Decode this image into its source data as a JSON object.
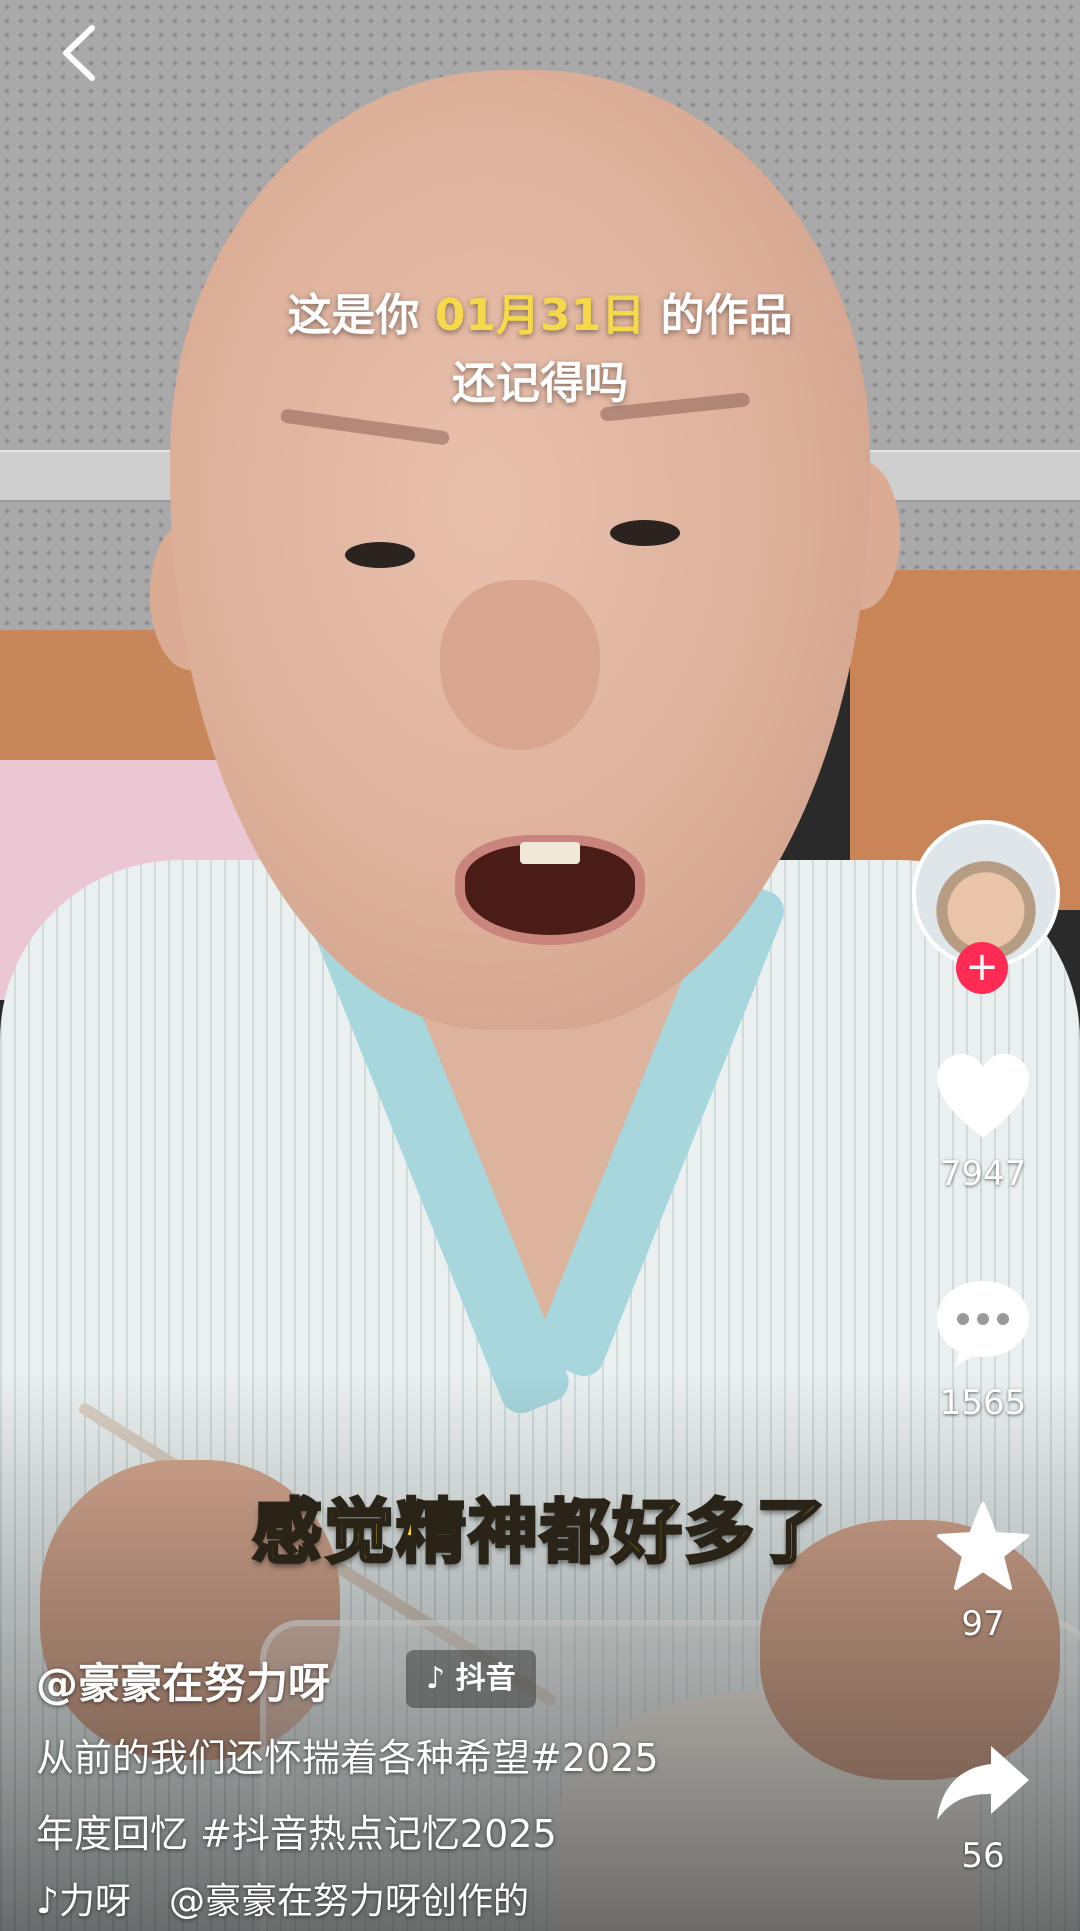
{
  "overlay_caption": {
    "line1_prefix": "这是你",
    "line1_date": "01月31日",
    "line1_suffix": "的作品",
    "line2": "还记得吗"
  },
  "subtitle": "感觉精神都好多了",
  "side_actions": {
    "likes": "7947",
    "comments": "1565",
    "favorites": "97",
    "shares": "56"
  },
  "author": {
    "handle": "@豪豪在努力呀"
  },
  "platform_badge": "抖音",
  "description": {
    "line1": "从前的我们还怀揣着各种希望#2025",
    "line2": "年度回忆 #抖音热点记忆2025"
  },
  "music": {
    "part1": "力呀",
    "part2": "@豪豪在努力呀创作的"
  },
  "colors": {
    "accent_date": "#f5d94a",
    "subtitle": "#f7d42a",
    "follow": "#fe2c55"
  },
  "icons": [
    "back-icon",
    "heart-icon",
    "comment-icon",
    "star-icon",
    "share-icon",
    "plus-icon",
    "music-note-icon"
  ]
}
